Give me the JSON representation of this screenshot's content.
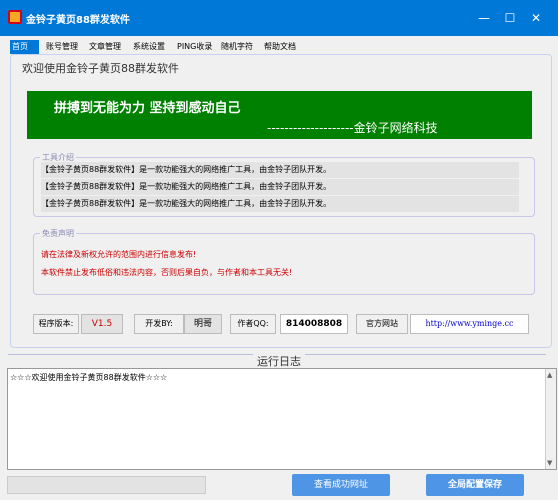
{
  "window": {
    "title": "金铃子黄页88群发软件",
    "controls": {
      "minimize": "—",
      "maximize": "☐",
      "close": "✕"
    }
  },
  "tabs": [
    {
      "label": "首页"
    },
    {
      "label": "账号管理"
    },
    {
      "label": "文章管理"
    },
    {
      "label": "系统设置"
    },
    {
      "label": "PING收录"
    },
    {
      "label": "随机字符"
    },
    {
      "label": "帮助文档"
    }
  ],
  "home": {
    "welcome_title": "欢迎使用金铃子黄页88群发软件",
    "banner": {
      "line1": "拼搏到无能为力  坚持到感动自己",
      "line2": "--------------------金铃子网络科技"
    },
    "tool_intro": {
      "label": "工具介绍",
      "lines": [
        "【金铃子黄页88群发软件】是一款功能强大的网络推广工具，由金铃子团队开发。",
        "【金铃子黄页88群发软件】是一款功能强大的网络推广工具，由金铃子团队开发。",
        "【金铃子黄页88群发软件】是一款功能强大的网络推广工具，由金铃子团队开发。"
      ]
    },
    "disclaimer": {
      "label": "免责声明",
      "lines": [
        "请在法律及新权允许的范围内进行信息发布!",
        "本软件禁止发布低俗和违法内容，否则后果自负，与作者和本工具无关!"
      ]
    },
    "info": {
      "version_label": "程序版本:",
      "version_value": "V1.5",
      "developer_label": "开发BY:",
      "developer_value": "明哥",
      "qq_label": "作者QQ:",
      "qq_value": "814008808",
      "website_label": "官方网站",
      "website_value": "http://www.yminge.cc"
    }
  },
  "log": {
    "title": "运行日志",
    "text": "☆☆☆欢迎使用金铃子黄页88群发软件☆☆☆"
  },
  "footer": {
    "view_success_button": "查看成功网址",
    "save_config_button": "全局配置保存"
  },
  "colors": {
    "accent": "#0078d7",
    "banner_green": "#008000",
    "version_red": "#cc0000",
    "website_blue": "#0000cc"
  }
}
